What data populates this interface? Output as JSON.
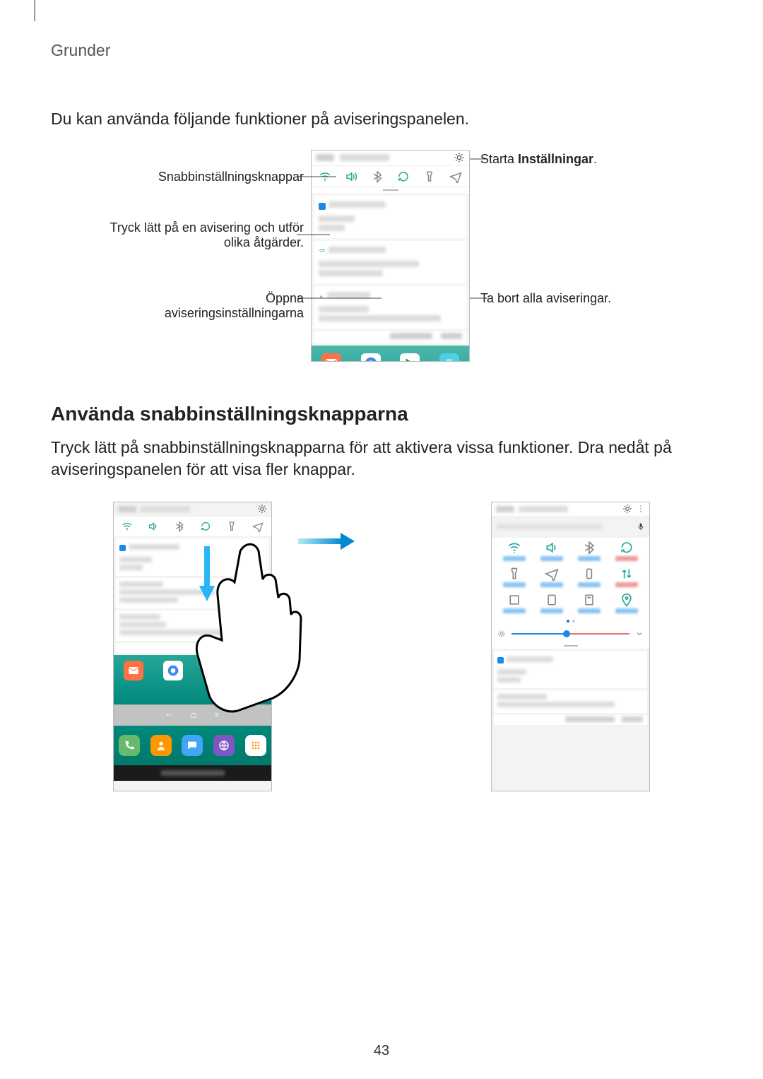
{
  "header": "Grunder",
  "intro": "Du kan använda följande funktioner på aviseringspanelen.",
  "fig1": {
    "left": {
      "quick_buttons": "Snabbinställningsknappar",
      "tap_notif_l1": "Tryck lätt på en avisering och utför",
      "tap_notif_l2": "olika åtgärder.",
      "open_l1": "Öppna",
      "open_l2": "aviseringsinställningarna"
    },
    "right": {
      "start_pre": "Starta ",
      "start_bold": "Inställningar",
      "start_post": ".",
      "clear_all": "Ta bort alla aviseringar."
    }
  },
  "section2": {
    "heading": "Använda snabbinställningsknapparna",
    "para": "Tryck lätt på snabbinställningsknapparna för att aktivera vissa funktioner. Dra nedåt på aviseringspanelen för att visa fler knappar."
  },
  "page_number": "43"
}
